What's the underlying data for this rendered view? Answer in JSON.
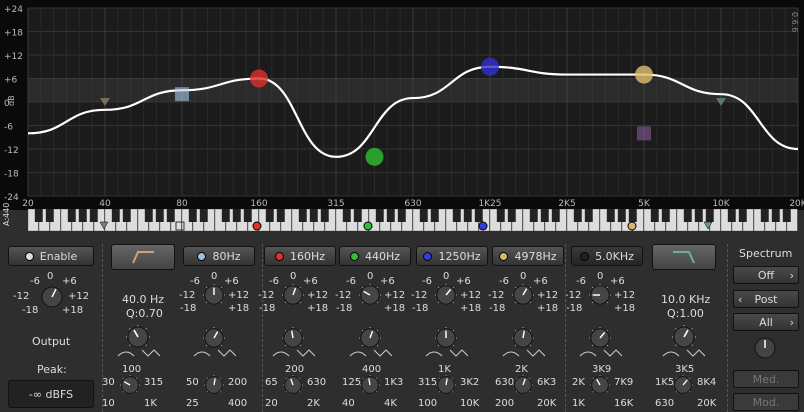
{
  "graph": {
    "db_labels": [
      "+24",
      "+18",
      "+12",
      "+6",
      "0",
      "-6",
      "-12",
      "-18",
      "-24"
    ],
    "db_unit": "dB",
    "freq_labels": [
      "20",
      "40",
      "80",
      "160",
      "315",
      "630",
      "1K25",
      "2K5",
      "5K",
      "10K",
      "20K"
    ],
    "corner_right": "0.6.6",
    "corner_left": "A:440"
  },
  "bands": [
    {
      "id": "hp",
      "freq": "40.0 Hz",
      "q": "Q:0.70",
      "ticks": [
        "100",
        "30",
        "315",
        "10",
        "1K"
      ],
      "color": "#9a8a6a"
    },
    {
      "id": "b1",
      "label": "80Hz",
      "color": "#a8c8e8",
      "led": "#9ec0e0",
      "ticks": [
        "50",
        "200",
        "25",
        "400"
      ]
    },
    {
      "id": "b2",
      "label": "160Hz",
      "color": "#e03030",
      "led": "#e03030",
      "ticks": [
        "200",
        "65",
        "630",
        "20",
        "2K"
      ]
    },
    {
      "id": "b3",
      "label": "440Hz",
      "color": "#30c030",
      "led": "#30c030",
      "ticks": [
        "400",
        "125",
        "1K3",
        "40",
        "4K"
      ]
    },
    {
      "id": "b4",
      "label": "1250Hz",
      "color": "#3030d0",
      "led": "#3040e0",
      "ticks": [
        "1K",
        "315",
        "3K2",
        "100",
        "10K"
      ]
    },
    {
      "id": "b5",
      "label": "4978Hz",
      "color": "#e0c070",
      "led": "#d8b868",
      "ticks": [
        "2K",
        "630",
        "6K3",
        "200",
        "20K"
      ]
    },
    {
      "id": "b6",
      "label": "5.0KHz",
      "color": "#8a5a9a",
      "led": "#222",
      "ticks": [
        "3K9",
        "2K",
        "7K9",
        "1K",
        "16K"
      ]
    },
    {
      "id": "lp",
      "freq": "10.0 KHz",
      "q": "Q:1.00",
      "ticks": [
        "3K5",
        "1K5",
        "8K4",
        "630",
        "20K"
      ],
      "color": "#6a9a8a"
    }
  ],
  "gain_ticks": {
    "neg6": "-6",
    "zero": "0",
    "pos6": "+6",
    "neg12": "-12",
    "pos12": "+12",
    "neg18": "-18",
    "pos18": "+18"
  },
  "left": {
    "enable": "Enable",
    "output": "Output",
    "peak": "Peak:",
    "peak_value": "-∞ dBFS"
  },
  "right": {
    "title": "Spectrum",
    "mode": "Off",
    "position": "Post",
    "channel": "All",
    "med": "Med.",
    "mod": "Mod."
  },
  "chart_data": {
    "type": "line",
    "x_label": "",
    "y_label": "dB",
    "x": [
      "20",
      "40",
      "80",
      "160",
      "315",
      "630",
      "1K25",
      "2K5",
      "5K",
      "10K",
      "20K"
    ],
    "ylim": [
      -24,
      24
    ],
    "series": [
      {
        "values": [
          -8,
          -2,
          3,
          6,
          -14,
          1,
          9,
          7,
          7,
          2,
          -12
        ]
      }
    ]
  }
}
